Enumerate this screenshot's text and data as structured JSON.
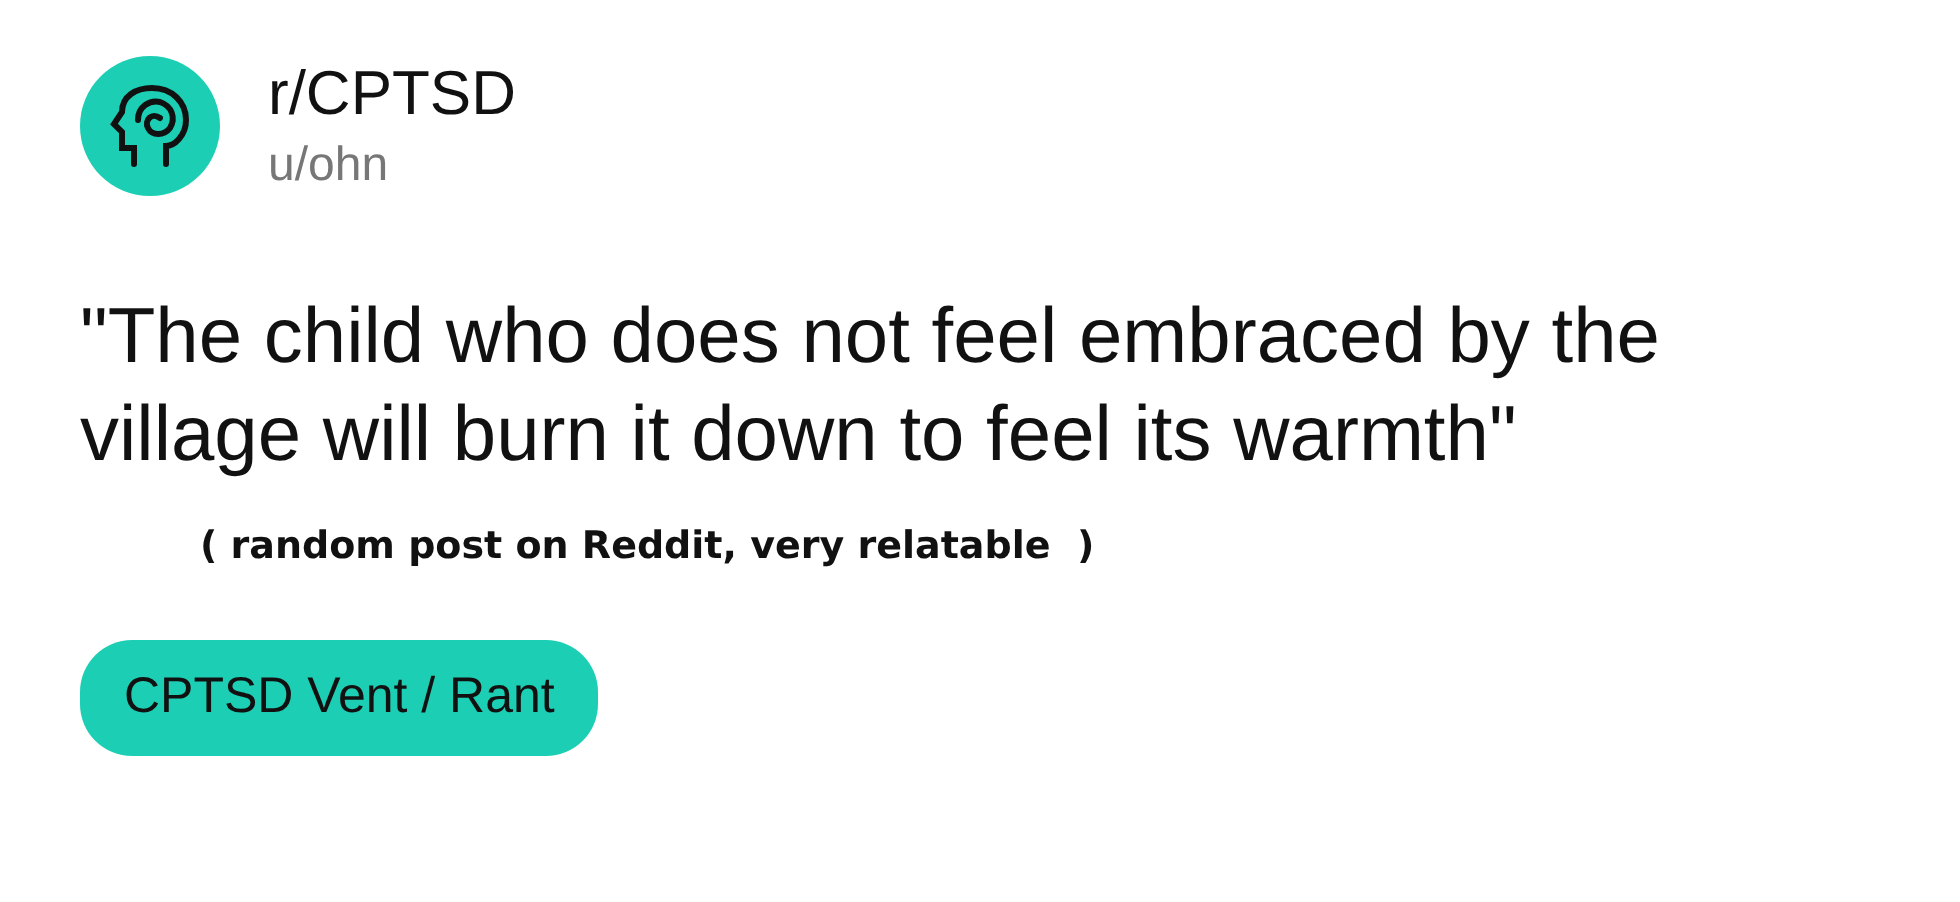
{
  "post": {
    "subreddit": "r/CPTSD",
    "username": "u/ohn",
    "title": "\"The child who does not feel embraced by the village will burn it down to feel its warmth\"",
    "note": "( random post on Reddit, very relatable  )",
    "flair": {
      "label": "CPTSD Vent / Rant",
      "color": "#1ccfb4"
    }
  }
}
